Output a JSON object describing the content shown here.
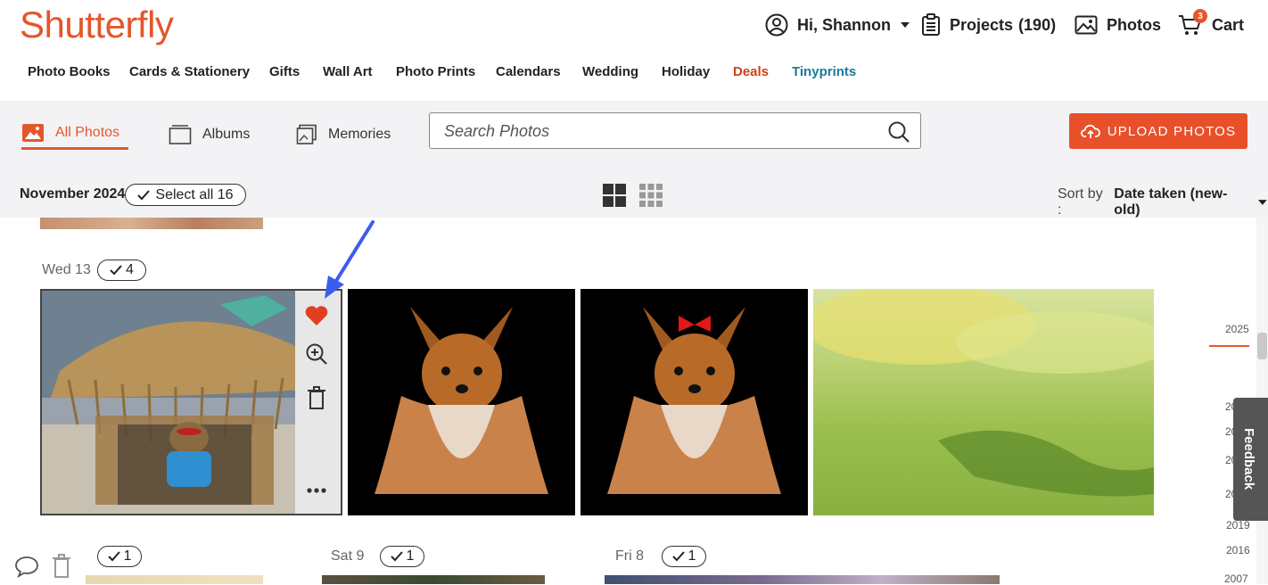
{
  "header": {
    "logo": "Shutterfly",
    "greeting": "Hi, Shannon",
    "projects": "Projects",
    "projects_count": "(190)",
    "photos": "Photos",
    "cart": "Cart",
    "cart_count": "3"
  },
  "nav": [
    "Photo Books",
    "Cards & Stationery",
    "Gifts",
    "Wall Art",
    "Photo Prints",
    "Calendars",
    "Wedding",
    "Holiday",
    "Deals",
    "Tinyprints"
  ],
  "tabs": {
    "all_photos": "All Photos",
    "albums": "Albums",
    "memories": "Memories"
  },
  "search": {
    "placeholder": "Search Photos"
  },
  "upload_label": "UPLOAD PHOTOS",
  "month_label": "November 2024",
  "select_all_label": "Select all 16",
  "sort": {
    "label": "Sort by :",
    "value": "Date taken (new-old)"
  },
  "days": [
    {
      "label": "Wed 13",
      "count": "4"
    },
    {
      "label": "",
      "count": "1"
    },
    {
      "label": "Sat 9",
      "count": "1"
    },
    {
      "label": "Fri 8",
      "count": "1"
    }
  ],
  "timeline": {
    "years": [
      "2025",
      "20",
      "20",
      "20",
      "20",
      "2019",
      "2016",
      "2007"
    ]
  },
  "feedback_label": "Feedback",
  "colors": {
    "brand": "#e4562b",
    "tinyprints": "#1a7a9a",
    "deals": "#d0401a"
  }
}
